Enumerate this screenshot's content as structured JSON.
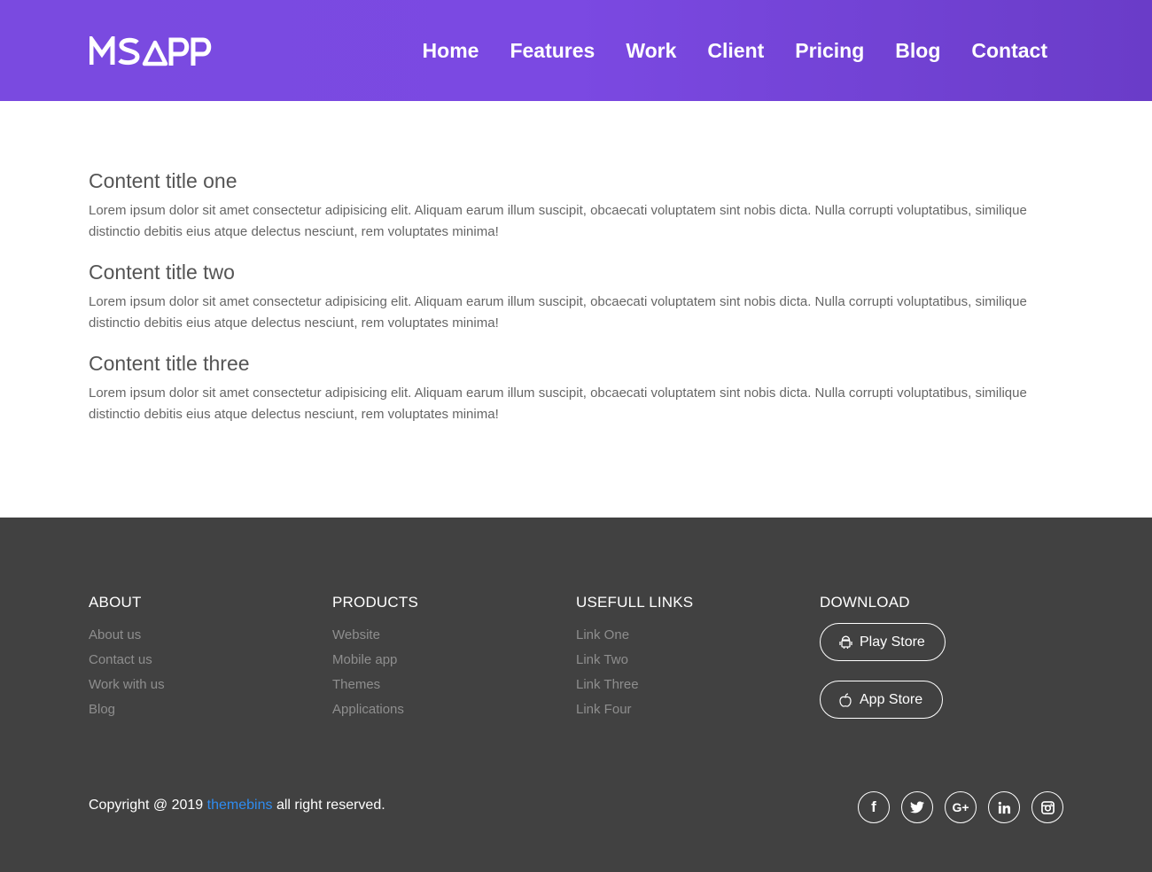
{
  "header": {
    "logo_text": "MSAPP",
    "nav": [
      "Home",
      "Features",
      "Work",
      "Client",
      "Pricing",
      "Blog",
      "Contact"
    ]
  },
  "main": {
    "sections": [
      {
        "title": "Content title one",
        "text": "Lorem ipsum dolor sit amet consectetur adipisicing elit. Aliquam earum illum suscipit, obcaecati voluptatem sint nobis dicta. Nulla corrupti voluptatibus, similique distinctio debitis eius atque delectus nesciunt, rem voluptates minima!"
      },
      {
        "title": "Content title two",
        "text": "Lorem ipsum dolor sit amet consectetur adipisicing elit. Aliquam earum illum suscipit, obcaecati voluptatem sint nobis dicta. Nulla corrupti voluptatibus, similique distinctio debitis eius atque delectus nesciunt, rem voluptates minima!"
      },
      {
        "title": "Content title three",
        "text": "Lorem ipsum dolor sit amet consectetur adipisicing elit. Aliquam earum illum suscipit, obcaecati voluptatem sint nobis dicta. Nulla corrupti voluptatibus, similique distinctio debitis eius atque delectus nesciunt, rem voluptates minima!"
      }
    ]
  },
  "footer": {
    "about": {
      "title": "ABOUT",
      "links": [
        "About us",
        "Contact us",
        "Work with us",
        "Blog"
      ]
    },
    "products": {
      "title": "PRODUCTS",
      "links": [
        "Website",
        "Mobile app",
        "Themes",
        "Applications"
      ]
    },
    "useful": {
      "title": "USEFULL LINKS",
      "links": [
        "Link One",
        "Link Two",
        "Link Three",
        "Link Four"
      ]
    },
    "download": {
      "title": "DOWNLOAD",
      "play_store": "Play Store",
      "app_store": "App Store"
    },
    "copyright_prefix": "Copyright @ 2019",
    "copyright_link": "themebins",
    "copyright_suffix": "all right reserved.",
    "social": {
      "facebook": "f",
      "google_plus": "G+"
    }
  },
  "colors": {
    "header_gradient_start": "#7a4ae0",
    "header_gradient_end": "#6a3cc8",
    "footer_bg": "#414141",
    "link_accent": "#2f8cf0"
  },
  "icons": [
    "android-icon",
    "apple-icon",
    "facebook-icon",
    "twitter-icon",
    "google-plus-icon",
    "linkedin-icon",
    "instagram-icon"
  ]
}
